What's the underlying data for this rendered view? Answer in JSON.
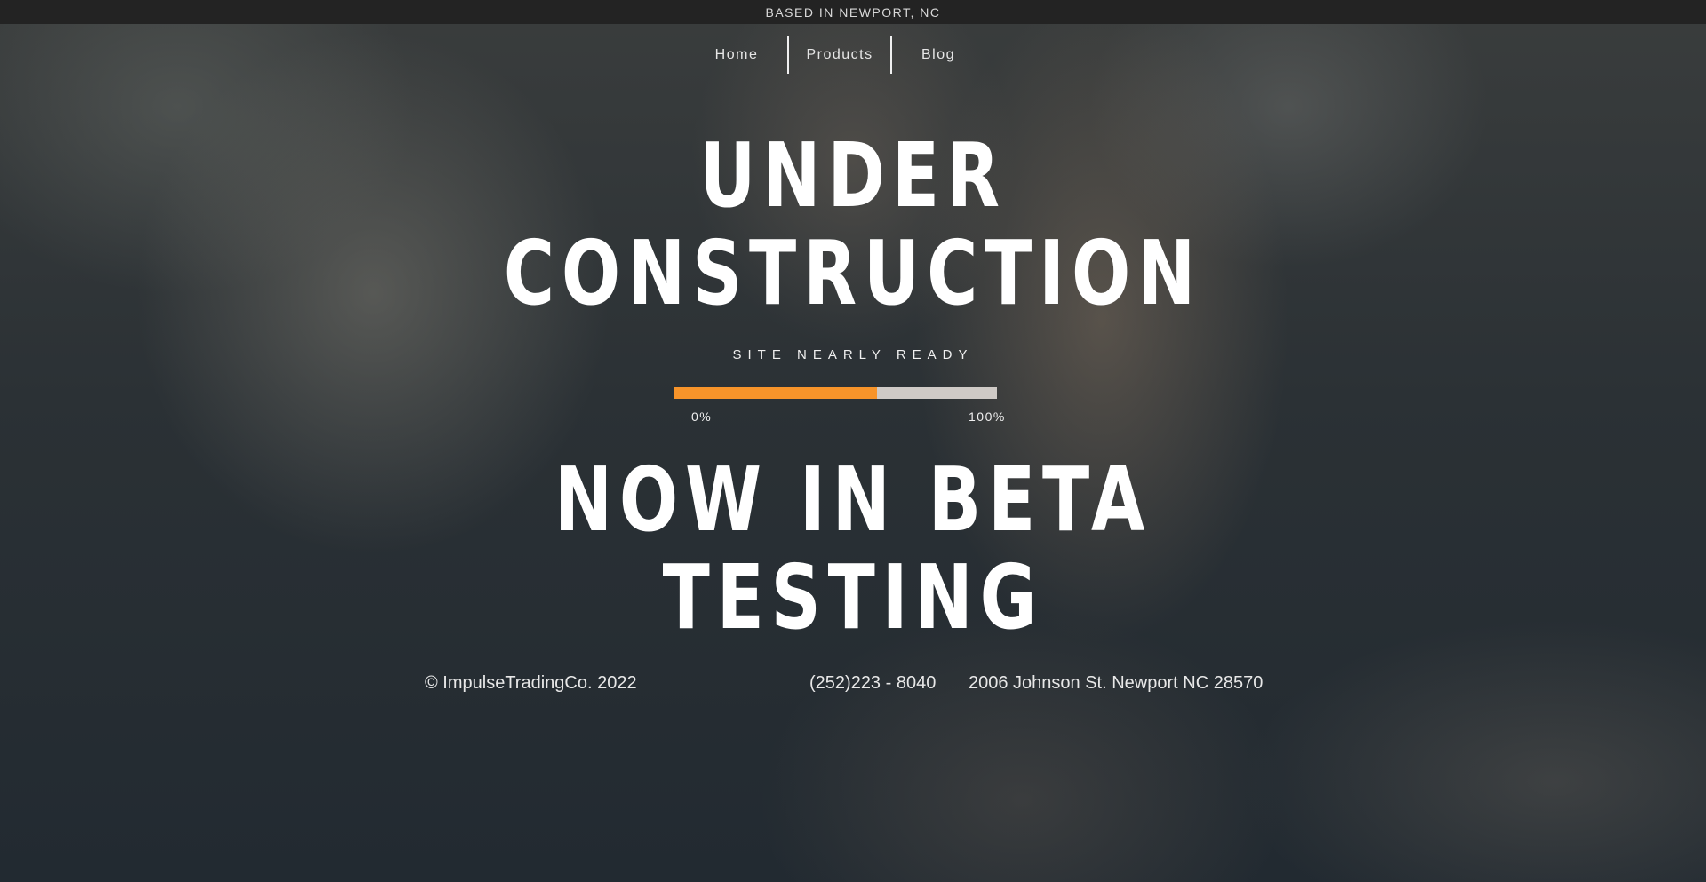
{
  "topbar": {
    "text": "BASED IN NEWPORT, NC"
  },
  "nav": {
    "items": [
      {
        "label": "Home"
      },
      {
        "label": "Products"
      },
      {
        "label": "Blog"
      }
    ]
  },
  "hero": {
    "headline_line1": "UNDER",
    "headline_line2": "CONSTRUCTION",
    "subtitle": "SITE NEARLY READY",
    "progress": {
      "value_percent": 63,
      "min_label": "0%",
      "max_label": "100%",
      "fill_color": "#f7942a",
      "track_color": "#cfcac6"
    },
    "secondary_line1": "NOW IN BETA",
    "secondary_line2": "TESTING"
  },
  "footer": {
    "copyright": "© ImpulseTradingCo. 2022",
    "phone": "(252)223 - 8040",
    "address": "2006 Johnson St. Newport NC 28570"
  }
}
